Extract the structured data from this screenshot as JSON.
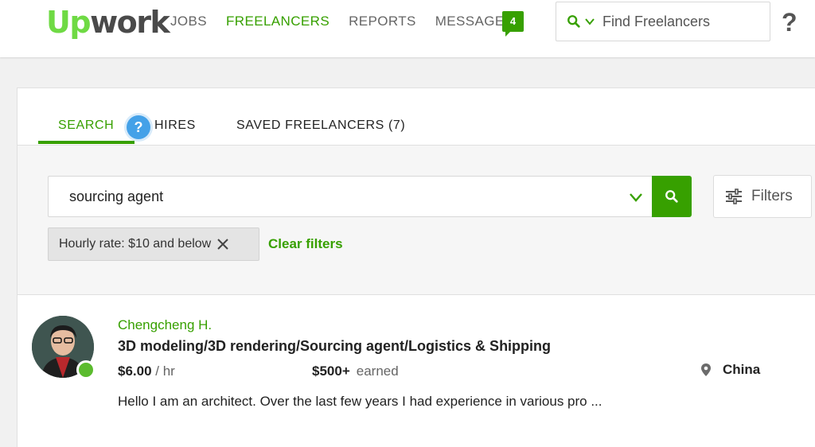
{
  "header": {
    "logo": {
      "up": "Up",
      "rest": "work"
    },
    "nav": [
      {
        "label": "JOBS",
        "active": false
      },
      {
        "label": "FREELANCERS",
        "active": true
      },
      {
        "label": "REPORTS",
        "active": false
      },
      {
        "label": "MESSAGES",
        "active": false
      }
    ],
    "messages_badge": "4",
    "search_placeholder": "Find Freelancers",
    "help_label": "?"
  },
  "tabs": {
    "items": [
      {
        "label": "SEARCH",
        "active": true
      },
      {
        "label": "HIRES",
        "active": false
      },
      {
        "label": "SAVED FREELANCERS (7)",
        "active": false
      }
    ],
    "help_bubble": "?"
  },
  "search": {
    "query": "sourcing agent",
    "filters_label": "Filters",
    "active_filter": "Hourly rate: $10 and below",
    "clear_label": "Clear filters"
  },
  "results": [
    {
      "name": "Chengcheng H.",
      "title": "3D modeling/3D rendering/Sourcing agent/Logistics & Shipping",
      "rate": "$6.00",
      "rate_unit": "/ hr",
      "earned": "$500+",
      "earned_label": "earned",
      "country": "China",
      "description": "Hello I am an architect. Over the last few years I had experience in various pro ...",
      "online": true
    }
  ],
  "colors": {
    "brand_green": "#37a000",
    "logo_green": "#6fda44",
    "help_blue": "#44a1e8",
    "online_green": "#5bbb2e"
  },
  "icons": [
    "search-icon",
    "chevron-down-icon",
    "help-icon",
    "sliders-icon",
    "close-icon",
    "location-pin-icon"
  ]
}
